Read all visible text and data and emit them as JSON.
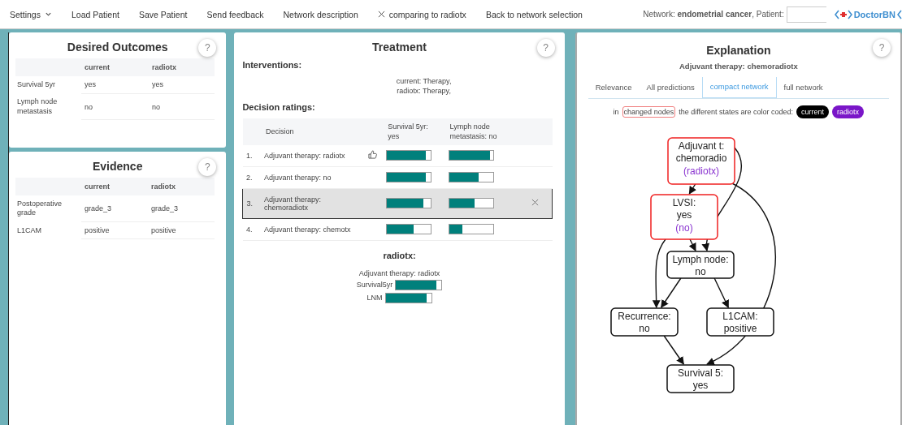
{
  "menu": [
    {
      "label": "Settings",
      "kind": "dropdown"
    },
    {
      "label": "Load Patient",
      "kind": "plain"
    },
    {
      "label": "Save Patient",
      "kind": "plain"
    },
    {
      "label": "Send feedback",
      "kind": "plain"
    },
    {
      "label": "Network description",
      "kind": "plain"
    },
    {
      "label": "comparing to radiotx",
      "kind": "closable"
    },
    {
      "label": "Back to network selection",
      "kind": "plain"
    }
  ],
  "network_info": "Network: **endometrial cancer**, Patient:",
  "logo": "DoctorBN",
  "desired_outcomes": {
    "title": "Desired Outcomes",
    "help": "?",
    "columns": [
      "current",
      "radiotx"
    ],
    "rows": [
      {
        "name": "Survival 5yr",
        "values": [
          "yes",
          "yes"
        ]
      },
      {
        "name": "Lymph node metastasis",
        "values": [
          "no",
          "no"
        ]
      }
    ]
  },
  "evidence": {
    "title": "Evidence",
    "help": "?",
    "columns": [
      "current",
      "radiotx"
    ],
    "rows": [
      {
        "name": "Postoperative grade",
        "values": [
          "grade_3",
          "grade_3"
        ]
      },
      {
        "name": "L1CAM",
        "values": [
          "positive",
          "positive"
        ]
      }
    ]
  },
  "treatment": {
    "title": "Treatment",
    "help": "?",
    "interventions_heading": "Interventions:",
    "interventions": [
      "current: Therapy,",
      "radiotx: Therapy,"
    ],
    "ratings_heading": "Decision ratings:",
    "columns": [
      "Decision",
      "Survival 5yr: yes",
      "Lymph node metastasis: no"
    ],
    "rows": [
      {
        "rank": "1.",
        "decision": "Adjuvant therapy: radiotx",
        "recommended": true,
        "selected": false,
        "survival": {
          "level": 0.88
        },
        "lnm": {
          "level": 0.93
        }
      },
      {
        "rank": "2.",
        "decision": "Adjuvant therapy: no",
        "recommended": false,
        "selected": false,
        "survival": {
          "level": 0.88
        },
        "lnm": {
          "level": 0.68
        }
      },
      {
        "rank": "3.",
        "decision": "Adjuvant therapy: chemoradiotx",
        "recommended": false,
        "selected": true,
        "survival": {
          "level": 0.82
        },
        "lnm": {
          "level": 0.58
        }
      },
      {
        "rank": "4.",
        "decision": "Adjuvant therapy: chemotx",
        "recommended": false,
        "selected": false,
        "survival": {
          "level": 0.6
        },
        "lnm": {
          "level": 0.3
        }
      }
    ],
    "comparison": {
      "title": "radiotx:",
      "decision": "Adjuvant therapy: radiotx",
      "bars": [
        {
          "label": "Survival5yr",
          "level": 0.88
        },
        {
          "label": "LNM",
          "level": 0.9
        }
      ]
    }
  },
  "explanation": {
    "title": "Explanation",
    "help": "?",
    "subtitle": "Adjuvant therapy: chemoradiotx",
    "tabs": [
      {
        "label": "Relevance",
        "selected": false
      },
      {
        "label": "All predictions",
        "selected": false
      },
      {
        "label": "compact network",
        "selected": true
      },
      {
        "label": "full network",
        "selected": false
      }
    ],
    "legend": {
      "prefix": "in",
      "changed": "changed nodes",
      "text": "the different states are color coded:",
      "states": [
        {
          "label": "current",
          "color": "#000000"
        },
        {
          "label": "radiotx",
          "color": "#7a16c8"
        }
      ]
    },
    "nodes": [
      {
        "name": "Adjuvant t:",
        "value": "chemoradio",
        "alt": "(radiotx)",
        "changed": true
      },
      {
        "name": "LVSI:",
        "value": "yes",
        "alt": "(no)",
        "changed": true
      },
      {
        "name": "Lymph node:",
        "value": "no",
        "changed": false
      },
      {
        "name": "Recurrence:",
        "value": "no",
        "changed": false
      },
      {
        "name": "L1CAM:",
        "value": "positive",
        "changed": false
      },
      {
        "name": "Survival 5:",
        "value": "yes",
        "changed": false
      }
    ]
  }
}
